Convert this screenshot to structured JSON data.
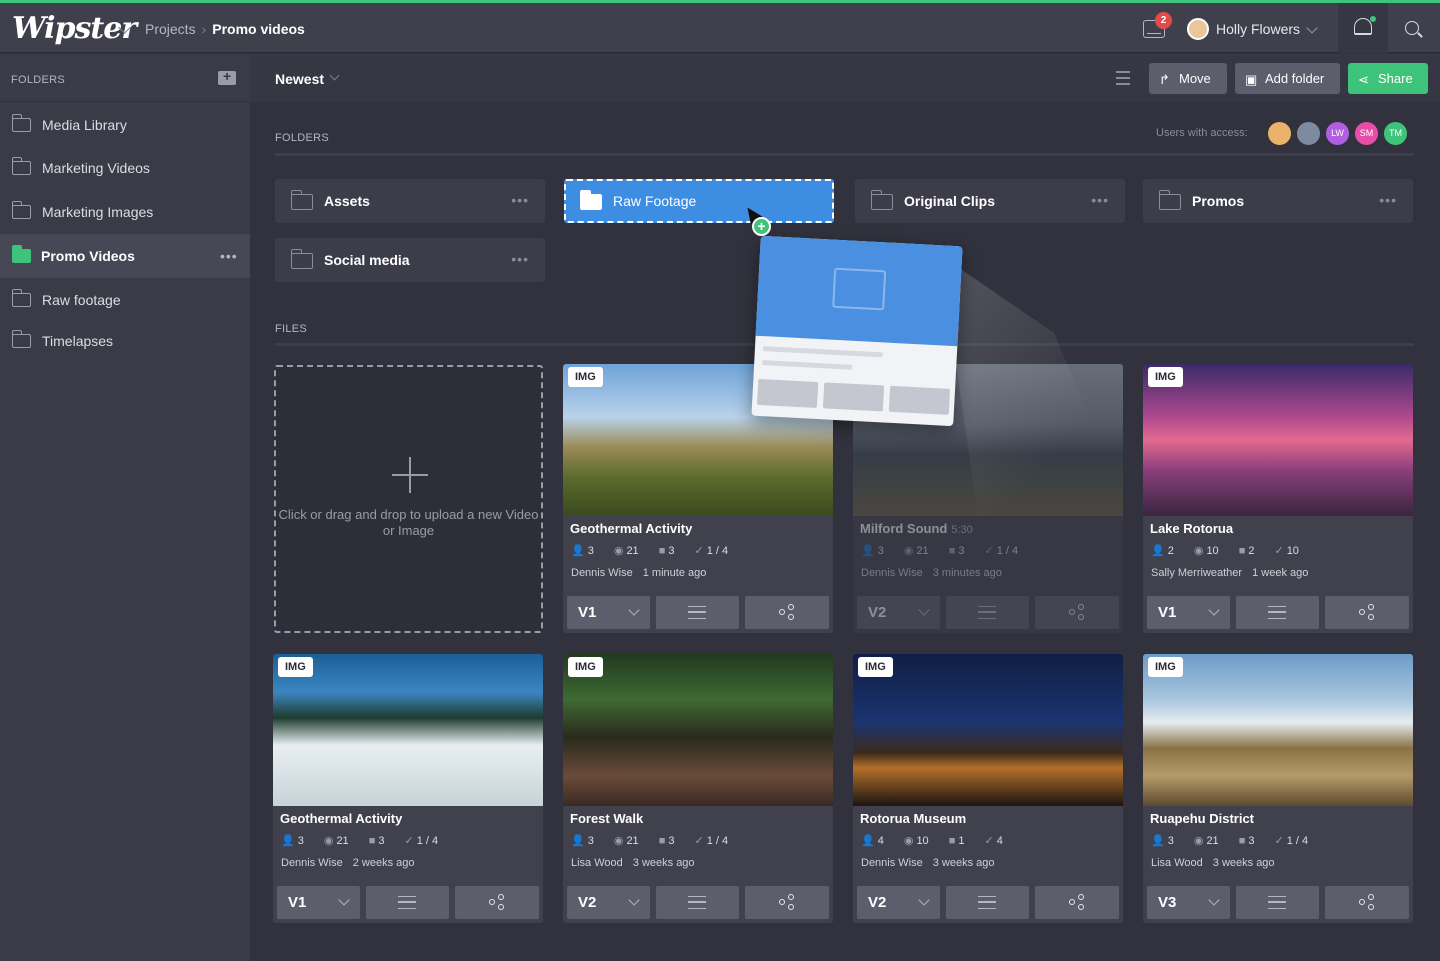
{
  "app": {
    "logo": "Wipster"
  },
  "breadcrumb": {
    "root": "Projects",
    "separator": "›",
    "current": "Promo videos"
  },
  "topbar": {
    "inbox_count": "2",
    "user_name": "Holly Flowers"
  },
  "sidebar": {
    "title": "FOLDERS",
    "items": [
      {
        "label": "Media Library"
      },
      {
        "label": "Marketing Videos"
      },
      {
        "label": "Marketing Images"
      },
      {
        "label": "Promo Videos",
        "more": "•••"
      },
      {
        "label": "Raw footage"
      },
      {
        "label": "Timelapses"
      }
    ]
  },
  "toolbar": {
    "sort": "Newest",
    "move": "Move",
    "add_folder": "Add folder",
    "share": "Share"
  },
  "folders_section": {
    "title": "FOLDERS",
    "access_label": "Users with access:",
    "avatars": [
      "",
      "",
      "LW",
      "SM",
      "TM"
    ],
    "folders": [
      "Assets",
      "Raw Footage",
      "Original Clips",
      "Promos",
      "Social media"
    ],
    "more": "•••"
  },
  "files_section": {
    "title": "FILES",
    "upload_text": "Click or drag and drop to upload a new Video or Image",
    "cards": [
      {
        "tag": "IMG",
        "title": "Geothermal Activity",
        "duration": "",
        "users": "3",
        "views": "21",
        "comments": "3",
        "approvals": "1 / 4",
        "author": "Dennis Wise",
        "time": "1 minute ago",
        "version": "V1"
      },
      {
        "tag": "",
        "title": "Milford Sound",
        "duration": "5:30",
        "users": "3",
        "views": "21",
        "comments": "3",
        "approvals": "1 / 4",
        "author": "Dennis Wise",
        "time": "3 minutes ago",
        "version": "V2"
      },
      {
        "tag": "IMG",
        "title": "Lake Rotorua",
        "duration": "",
        "users": "2",
        "views": "10",
        "comments": "2",
        "approvals": "10",
        "author": "Sally Merriweather",
        "time": "1 week ago",
        "version": "V1"
      },
      {
        "tag": "IMG",
        "title": "Geothermal Activity",
        "duration": "",
        "users": "3",
        "views": "21",
        "comments": "3",
        "approvals": "1 / 4",
        "author": "Dennis Wise",
        "time": "2 weeks ago",
        "version": "V1"
      },
      {
        "tag": "IMG",
        "title": "Forest Walk",
        "duration": "",
        "users": "3",
        "views": "21",
        "comments": "3",
        "approvals": "1 / 4",
        "author": "Lisa Wood",
        "time": "3 weeks ago",
        "version": "V2"
      },
      {
        "tag": "IMG",
        "title": "Rotorua Museum",
        "duration": "",
        "users": "4",
        "views": "10",
        "comments": "1",
        "approvals": "4",
        "author": "Dennis Wise",
        "time": "3 weeks ago",
        "version": "V2"
      },
      {
        "tag": "IMG",
        "title": "Ruapehu District",
        "duration": "",
        "users": "3",
        "views": "21",
        "comments": "3",
        "approvals": "1 / 4",
        "author": "Lisa Wood",
        "time": "3 weeks ago",
        "version": "V3"
      }
    ]
  },
  "colors": {
    "accent": "#3ec47a",
    "drop_target": "#3d8de3",
    "badge": "#e14b4b"
  },
  "icons": {
    "stats": [
      "user-icon",
      "eye-icon",
      "comment-icon",
      "check-icon"
    ]
  }
}
